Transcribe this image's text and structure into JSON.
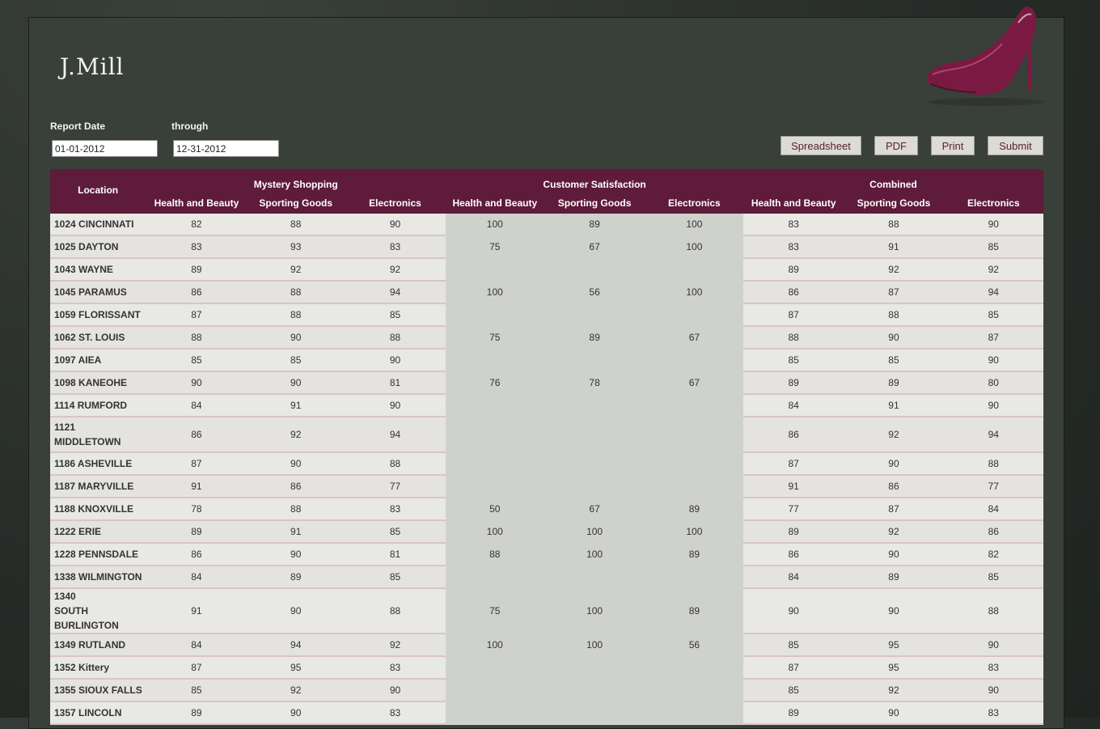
{
  "brand": "J.Mill",
  "filters": {
    "report_date_label": "Report Date",
    "report_date_value": "01-01-2012",
    "through_label": "through",
    "through_value": "12-31-2012"
  },
  "buttons": {
    "spreadsheet": "Spreadsheet",
    "pdf": "PDF",
    "print": "Print",
    "submit": "Submit"
  },
  "table": {
    "location_header": "Location",
    "groups": [
      "Mystery Shopping",
      "Customer Satisfaction",
      "Combined"
    ],
    "subheaders": [
      "Health and Beauty",
      "Sporting Goods",
      "Electronics"
    ],
    "rows": [
      {
        "loc": "1024 CINCINNATI",
        "v": [
          "82",
          "88",
          "90",
          "100",
          "89",
          "100",
          "83",
          "88",
          "90"
        ],
        "tall": false
      },
      {
        "loc": "1025 DAYTON",
        "v": [
          "83",
          "93",
          "83",
          "75",
          "67",
          "100",
          "83",
          "91",
          "85"
        ],
        "tall": false
      },
      {
        "loc": "1043 WAYNE",
        "v": [
          "89",
          "92",
          "92",
          "",
          "",
          "",
          "89",
          "92",
          "92"
        ],
        "tall": false
      },
      {
        "loc": "1045 PARAMUS",
        "v": [
          "86",
          "88",
          "94",
          "100",
          "56",
          "100",
          "86",
          "87",
          "94"
        ],
        "tall": false
      },
      {
        "loc": "1059 FLORISSANT",
        "v": [
          "87",
          "88",
          "85",
          "",
          "",
          "",
          "87",
          "88",
          "85"
        ],
        "tall": false
      },
      {
        "loc": "1062 ST. LOUIS",
        "v": [
          "88",
          "90",
          "88",
          "75",
          "89",
          "67",
          "88",
          "90",
          "87"
        ],
        "tall": false
      },
      {
        "loc": "1097 AIEA",
        "v": [
          "85",
          "85",
          "90",
          "",
          "",
          "",
          "85",
          "85",
          "90"
        ],
        "tall": false
      },
      {
        "loc": "1098 KANEOHE",
        "v": [
          "90",
          "90",
          "81",
          "76",
          "78",
          "67",
          "89",
          "89",
          "80"
        ],
        "tall": false
      },
      {
        "loc": "1114 RUMFORD",
        "v": [
          "84",
          "91",
          "90",
          "",
          "",
          "",
          "84",
          "91",
          "90"
        ],
        "tall": false
      },
      {
        "loc": "1121 MIDDLETOWN",
        "v": [
          "86",
          "92",
          "94",
          "",
          "",
          "",
          "86",
          "92",
          "94"
        ],
        "tall": true
      },
      {
        "loc": "1186 ASHEVILLE",
        "v": [
          "87",
          "90",
          "88",
          "",
          "",
          "",
          "87",
          "90",
          "88"
        ],
        "tall": false
      },
      {
        "loc": "1187 MARYVILLE",
        "v": [
          "91",
          "86",
          "77",
          "",
          "",
          "",
          "91",
          "86",
          "77"
        ],
        "tall": false
      },
      {
        "loc": "1188 KNOXVILLE",
        "v": [
          "78",
          "88",
          "83",
          "50",
          "67",
          "89",
          "77",
          "87",
          "84"
        ],
        "tall": false
      },
      {
        "loc": "1222 ERIE",
        "v": [
          "89",
          "91",
          "85",
          "100",
          "100",
          "100",
          "89",
          "92",
          "86"
        ],
        "tall": false
      },
      {
        "loc": "1228 PENNSDALE",
        "v": [
          "86",
          "90",
          "81",
          "88",
          "100",
          "89",
          "86",
          "90",
          "82"
        ],
        "tall": false
      },
      {
        "loc": "1338 WILMINGTON",
        "v": [
          "84",
          "89",
          "85",
          "",
          "",
          "",
          "84",
          "89",
          "85"
        ],
        "tall": false
      },
      {
        "loc": "1340 SOUTH BURLINGTON",
        "v": [
          "91",
          "90",
          "88",
          "75",
          "100",
          "89",
          "90",
          "90",
          "88"
        ],
        "tall": true
      },
      {
        "loc": "1349 RUTLAND",
        "v": [
          "84",
          "94",
          "92",
          "100",
          "100",
          "56",
          "85",
          "95",
          "90"
        ],
        "tall": false
      },
      {
        "loc": "1352 Kittery",
        "v": [
          "87",
          "95",
          "83",
          "",
          "",
          "",
          "87",
          "95",
          "83"
        ],
        "tall": false
      },
      {
        "loc": "1355 SIOUX FALLS",
        "v": [
          "85",
          "92",
          "90",
          "",
          "",
          "",
          "85",
          "92",
          "90"
        ],
        "tall": false
      },
      {
        "loc": "1357 LINCOLN",
        "v": [
          "89",
          "90",
          "83",
          "",
          "",
          "",
          "89",
          "90",
          "83"
        ],
        "tall": false
      }
    ]
  },
  "colors": {
    "header_bg": "#5e1b3b",
    "good": "#2e9a2e",
    "bad": "#e0262a",
    "panel_bg": "#394039"
  }
}
